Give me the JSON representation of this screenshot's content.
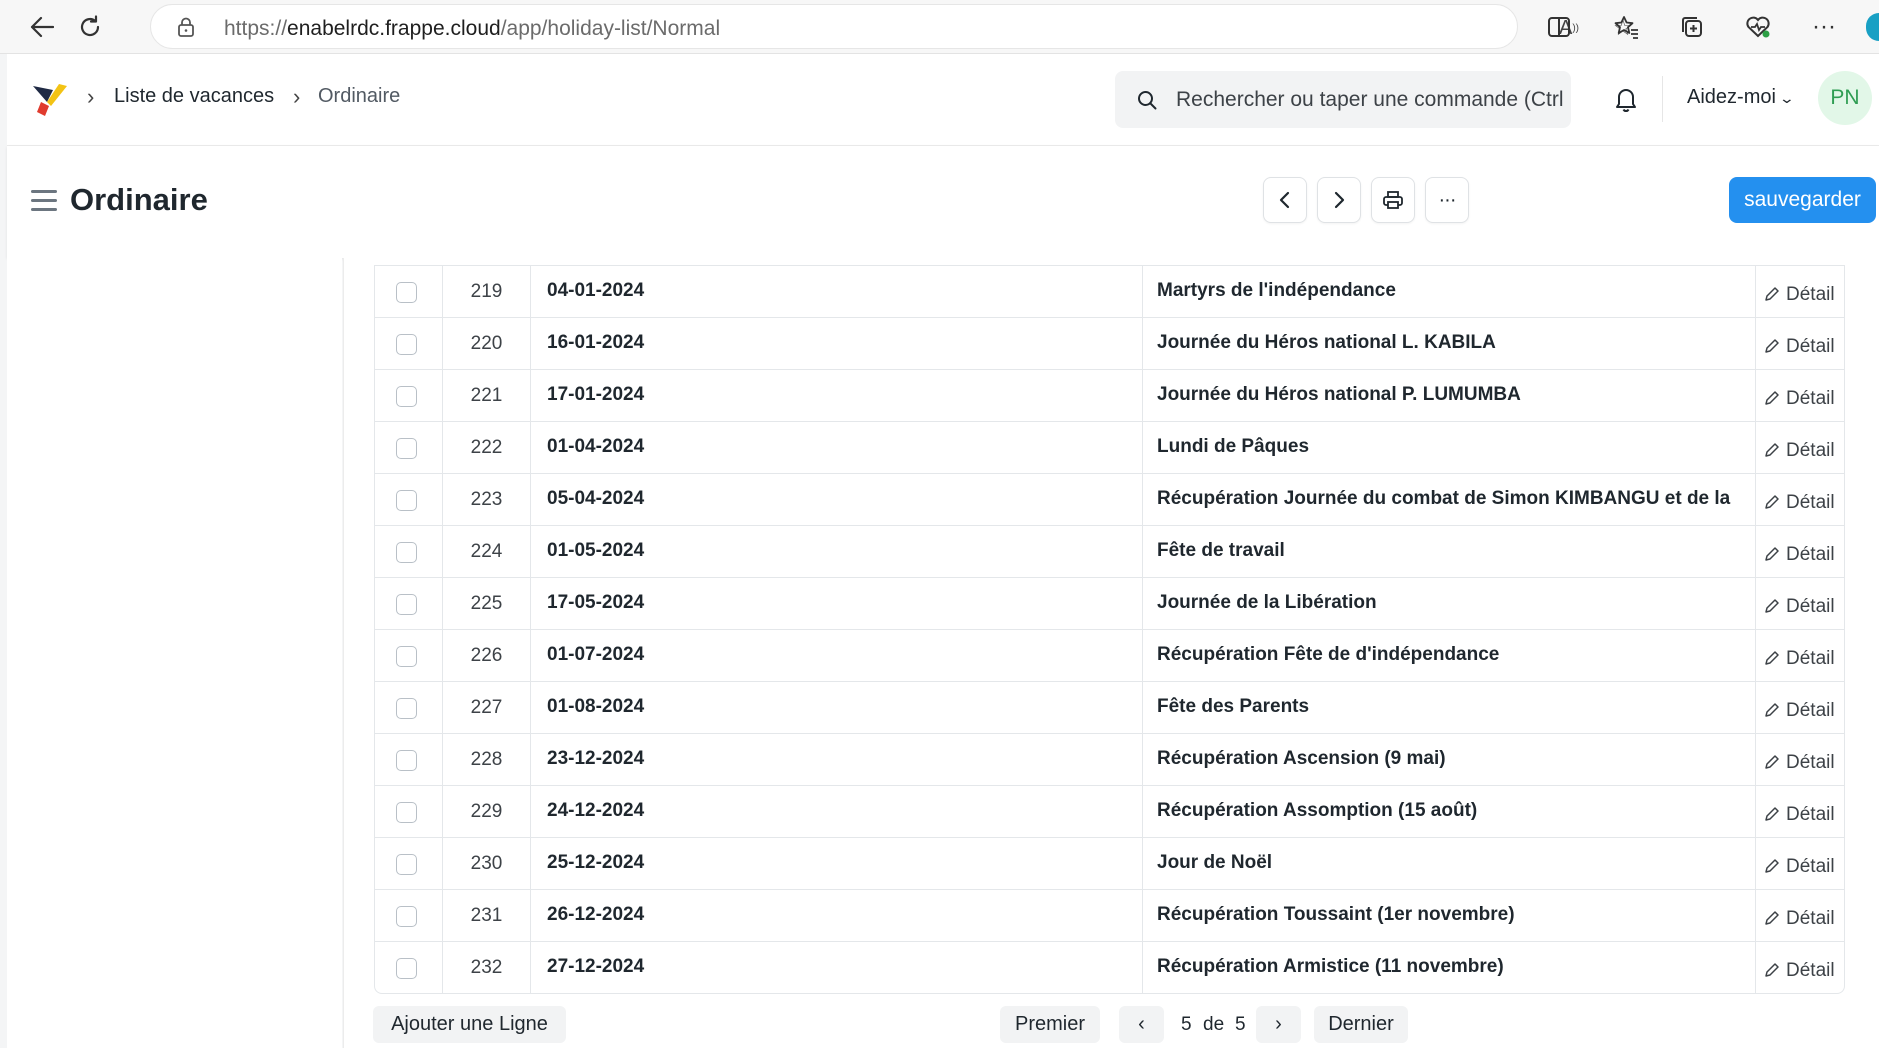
{
  "browser": {
    "url_prefix": "https://",
    "url_host": "enabelrdc.frappe.cloud",
    "url_path": "/app/holiday-list/Normal"
  },
  "navbar": {
    "breadcrumbs": [
      "Liste de vacances",
      "Ordinaire"
    ],
    "search_placeholder": "Rechercher ou taper une commande (Ctrl",
    "help_label": "Aidez-moi",
    "avatar_initials": "PN"
  },
  "page": {
    "title": "Ordinaire",
    "save_label": "sauvegarder"
  },
  "table": {
    "edit_label": "Détail",
    "rows": [
      {
        "idx": "219",
        "date": "04-01-2024",
        "description": "Martyrs de l'indépendance"
      },
      {
        "idx": "220",
        "date": "16-01-2024",
        "description": "Journée du Héros national L. KABILA"
      },
      {
        "idx": "221",
        "date": "17-01-2024",
        "description": "Journée du Héros national P. LUMUMBA"
      },
      {
        "idx": "222",
        "date": "01-04-2024",
        "description": "Lundi de Pâques"
      },
      {
        "idx": "223",
        "date": "05-04-2024",
        "description": "Récupération Journée du combat de Simon KIMBANGU et de la"
      },
      {
        "idx": "224",
        "date": "01-05-2024",
        "description": "Fête de travail"
      },
      {
        "idx": "225",
        "date": "17-05-2024",
        "description": "Journée de la Libération"
      },
      {
        "idx": "226",
        "date": "01-07-2024",
        "description": "Récupération Fête de d'indépendance"
      },
      {
        "idx": "227",
        "date": "01-08-2024",
        "description": "Fête des Parents"
      },
      {
        "idx": "228",
        "date": "23-12-2024",
        "description": "Récupération Ascension (9 mai)"
      },
      {
        "idx": "229",
        "date": "24-12-2024",
        "description": "Récupération Assomption (15 août)"
      },
      {
        "idx": "230",
        "date": "25-12-2024",
        "description": "Jour de Noël"
      },
      {
        "idx": "231",
        "date": "26-12-2024",
        "description": "Récupération Toussaint (1er novembre)"
      },
      {
        "idx": "232",
        "date": "27-12-2024",
        "description": "Récupération Armistice (11 novembre)"
      }
    ]
  },
  "footer": {
    "add_row_label": "Ajouter une Ligne",
    "first_label": "Premier",
    "last_label": "Dernier",
    "prev_symbol": "‹",
    "next_symbol": "›",
    "current_page": "5",
    "of_label": "de",
    "total_pages": "5"
  }
}
